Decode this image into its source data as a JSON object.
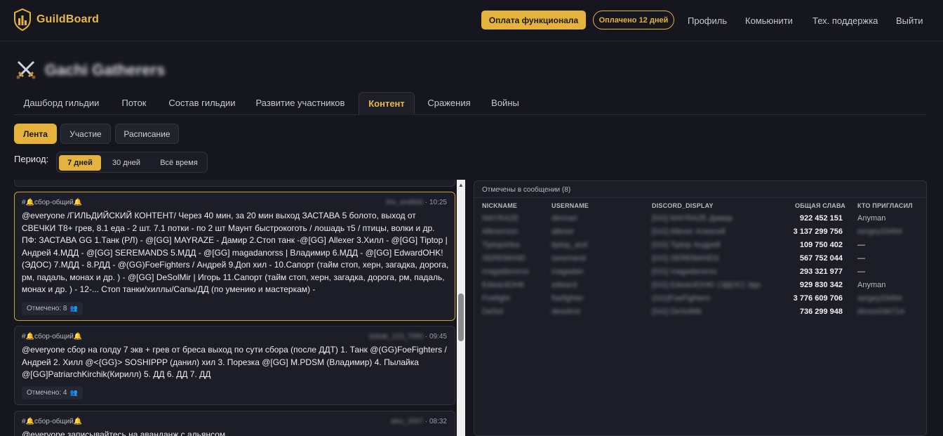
{
  "header": {
    "app_name": "GuildBoard",
    "pay_button": "Оплата функционала",
    "paid_badge": "Оплачено 12 дней",
    "nav": [
      "Профиль",
      "Комьюнити",
      "Тех. поддержка",
      "Выйти"
    ]
  },
  "guild": {
    "name": "Gachi Gatherers"
  },
  "tabs": [
    "Дашборд гильдии",
    "Поток",
    "Состав гильдии",
    "Развитие участников",
    "Контент",
    "Сражения",
    "Войны"
  ],
  "active_tab": "Контент",
  "subtabs": [
    "Лента",
    "Участие",
    "Расписание"
  ],
  "period": {
    "label": "Период:",
    "options": [
      "7 дней",
      "30 дней",
      "Всё время"
    ]
  },
  "feed": [
    {
      "channel": "#🔔сбор-общий🔔",
      "author": "the_and666",
      "time": "10:25",
      "text": "@everyone /ГИЛЬДИЙСКИЙ КОНТЕНТ/ Через 40 мин, за 20 мин выход ЗАСТАВА 5 болото, выход от СВЕЧКИ T8+ грев, 8.1 еда - 2 шт. 7.1 потки - по 2 шт Маунт быстрокоготь / лошадь т5 / птицы, волки и др. ПФ: ЗАСТАВА GG 1.Танк (РЛ) - @[GG] MAYRAZE - Дамир 2.Стоп танк -@[GG] Allexer 3.Хилл - @[GG] Tiptop | Андрей 4.МДД - @[GG] SEREMANDS 5.МДД - @[GG] magadanorss | Владимир 6.МДД - @[GG] EdwardOHK! (ЭДОС) 7.МДД - 8.РДД - @(GG)FoeFighters / Андрей 9.Доп хил - 10.Сапорт (тайм стоп, херн, загадка, дорога, рм, падаль, монах и др. ) - @[GG] DeSolMir | Игорь 11.Сапорт (тайм стоп, херн, загадка, дорога, рм, падаль, монах и др. ) - 12-... Стоп танки/хиллы/Сапы/ДД (по умению и мастеркам) -",
      "mentioned": "Отмечено: 8"
    },
    {
      "channel": "#🔔сбор-общий🔔",
      "author": "dobak_123_7990",
      "time": "09:45",
      "text": "@everyone сбор на голду 7 экв + грев от бреса выход по сути сбора (после ДДТ) 1. Танк @(GG)FoeFighters / Андрей 2. Хилл @<{GG}> SOSHIPPP (данил) хил 3. Порезка @[GG] M.PDSM (Владимир) 4. Пылайка @[GG]PatriarchKirchik(Кирилл) 5. ДД 6. ДД 7. ДД",
      "mentioned": "Отмечено: 4"
    },
    {
      "channel": "#🔔сбор-общий🔔",
      "author": "alex_2007",
      "time": "08:32",
      "text": "@everyone записывайтесь на аванданж с альянсом",
      "mentioned": ""
    }
  ],
  "mentions_panel": {
    "title": "Отмечены в сообщении (8)",
    "columns": [
      "NICKNAME",
      "USERNAME",
      "DISCORD_DISPLAY",
      "ОБЩАЯ СЛАВА",
      "КТО ПРИГЛАСИЛ"
    ],
    "rows": [
      {
        "nickname": "MAYRAZE",
        "username": "dinmart",
        "display": "[GG] MAYRAZE Дамир",
        "fame": "922 452 151",
        "invited": "Anyman"
      },
      {
        "nickname": "Allexerson",
        "username": "allexer",
        "display": "[GG] Allexer Алексей",
        "fame": "3 137 299 756",
        "invited": "sergey33494"
      },
      {
        "nickname": "Tiptopshka",
        "username": "tiptop_and",
        "display": "[GG] Tiptop Андрей",
        "fame": "109 750 402",
        "invited": "—"
      },
      {
        "nickname": "SEREMAND",
        "username": "seremand",
        "display": "[GG] SEREMANDS",
        "fame": "567 752 044",
        "invited": "—"
      },
      {
        "nickname": "magadanorss",
        "username": "magadan",
        "display": "[GG] magadanorss",
        "fame": "293 321 977",
        "invited": "—"
      },
      {
        "nickname": "EdwardOHK",
        "username": "edward",
        "display": "[GG] EdwardOHK! (ЭДОС) Эдо",
        "fame": "929 830 342",
        "invited": "Anyman"
      },
      {
        "nickname": "Foefight",
        "username": "foefighter",
        "display": "(GG)FoeFighters",
        "fame": "3 776 609 706",
        "invited": "sergey33494"
      },
      {
        "nickname": "DeSol",
        "username": "desolmir",
        "display": "[GG] DeSolMir",
        "fame": "736 299 948",
        "invited": "dimon046714"
      }
    ]
  },
  "colors": {
    "accent": "#e5b23c",
    "background": "#16161e",
    "panel": "#1d1d27"
  }
}
